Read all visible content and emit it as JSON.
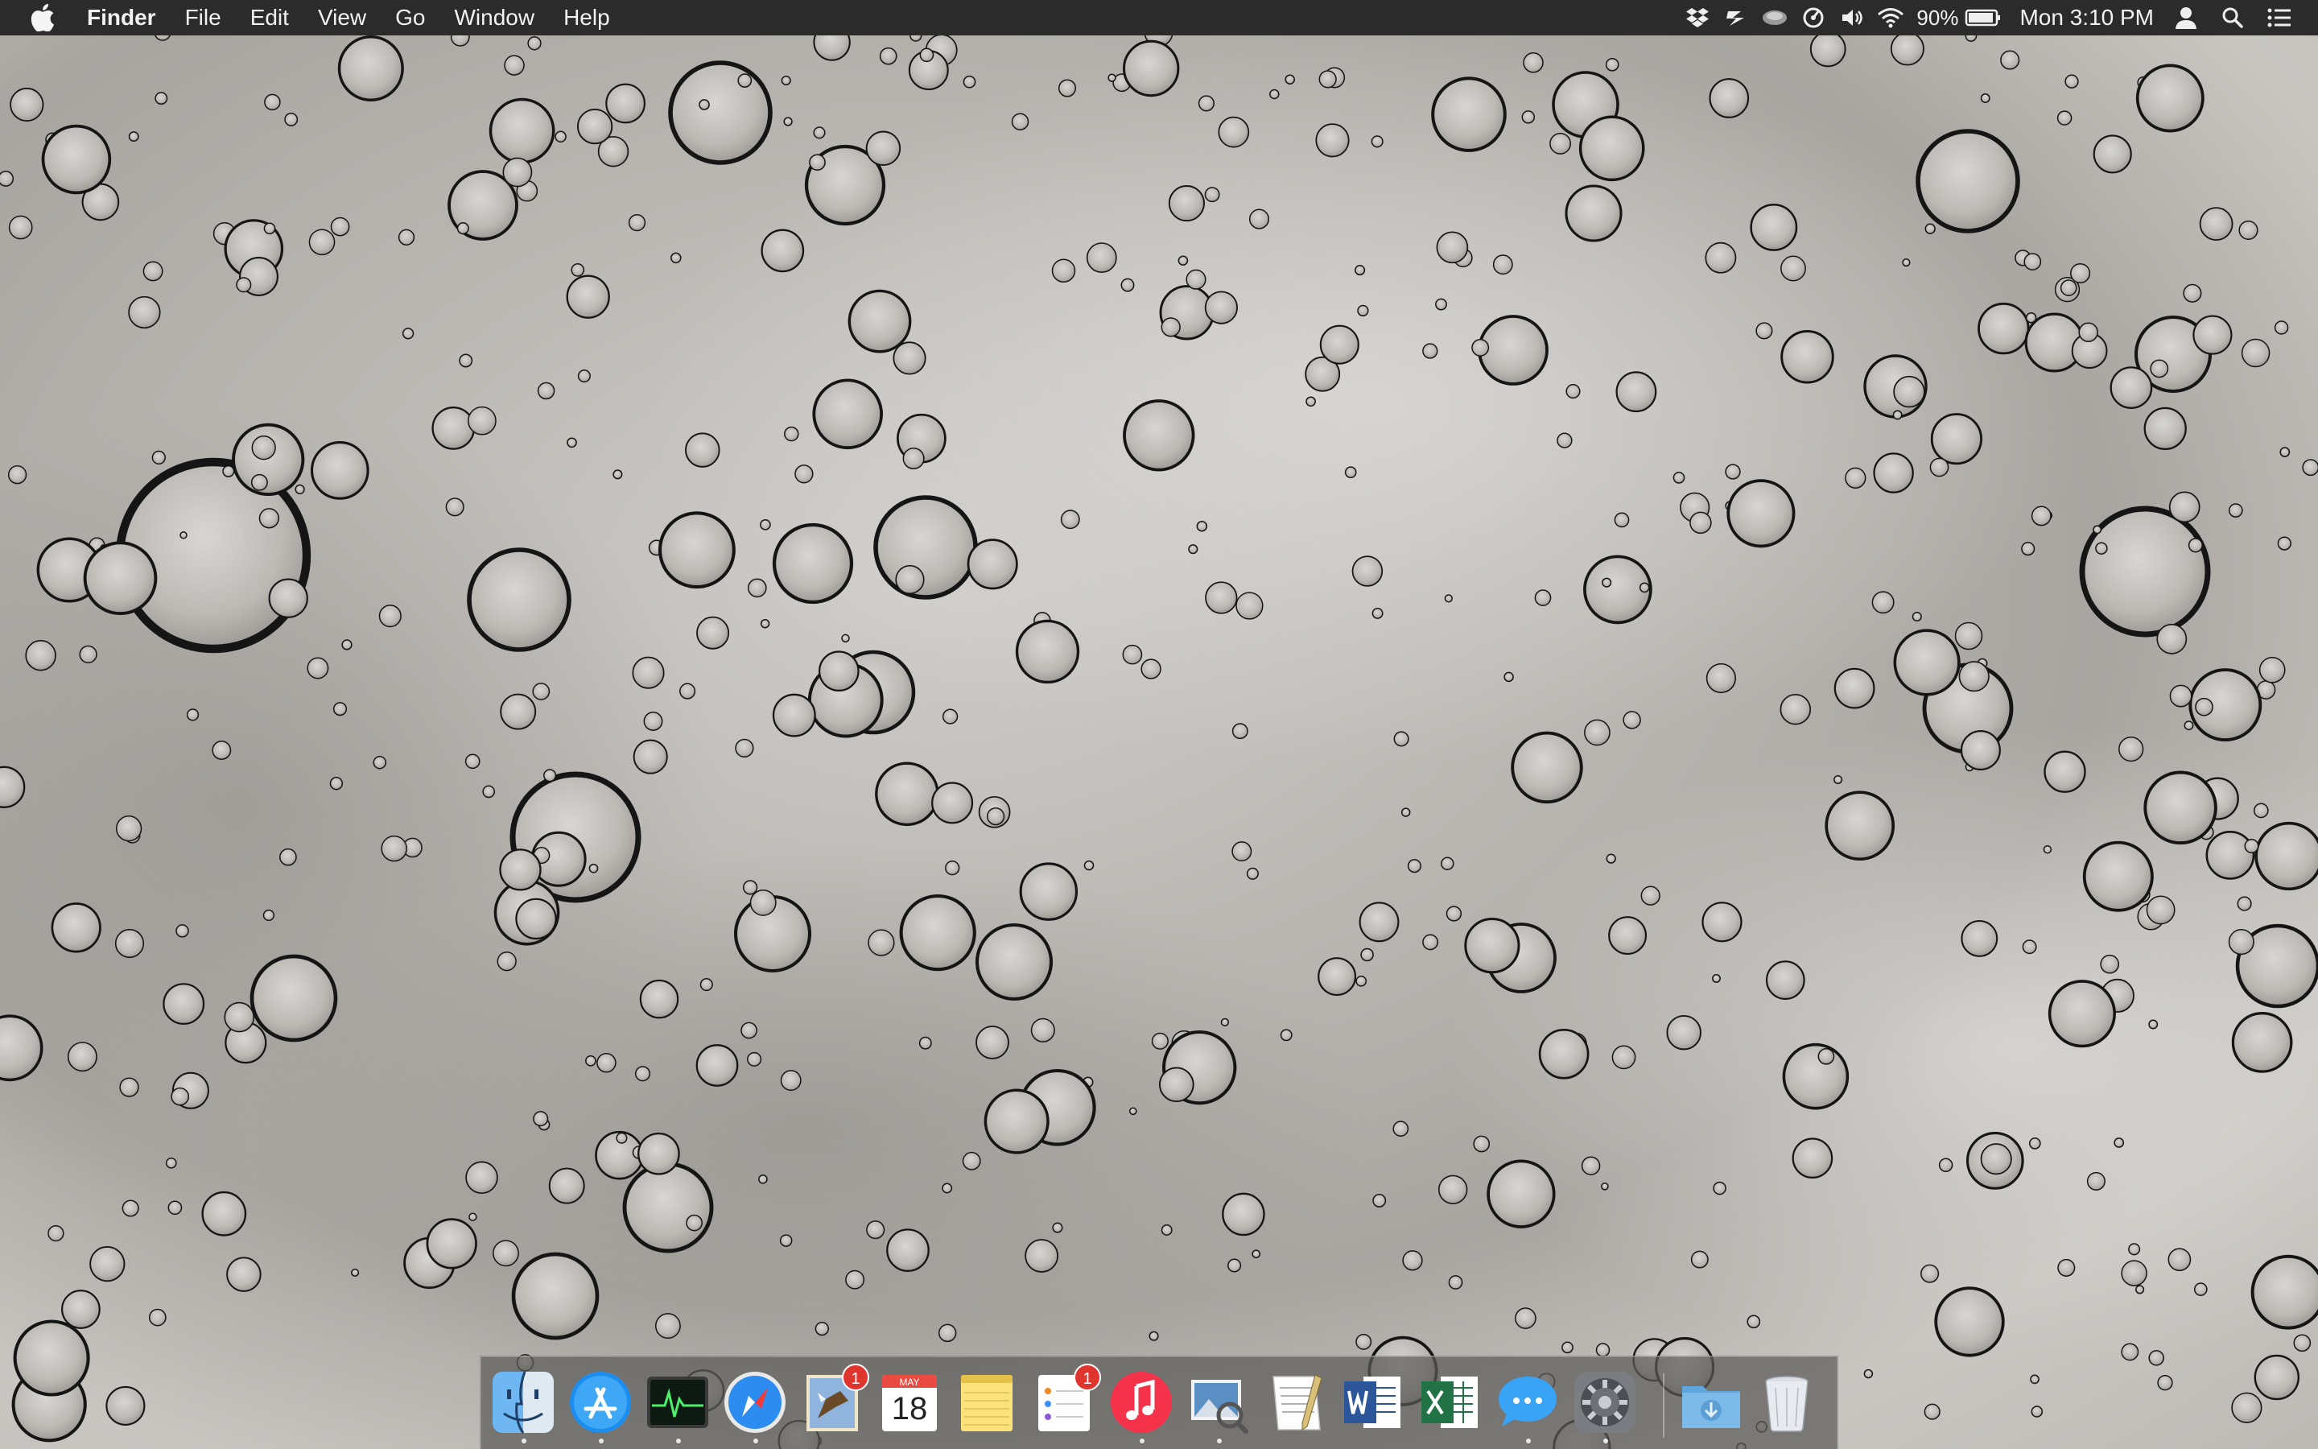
{
  "menubar": {
    "app_name": "Finder",
    "menus": [
      "File",
      "Edit",
      "View",
      "Go",
      "Window",
      "Help"
    ],
    "status_icons": [
      "dropbox-icon",
      "evernote-icon",
      "drive-icon",
      "sync-icon",
      "volume-icon",
      "wifi-icon"
    ],
    "battery_percent": "90%",
    "clock": "Mon 3:10 PM"
  },
  "dock": {
    "apps": [
      {
        "name": "Finder",
        "icon": "finder-icon",
        "running": true
      },
      {
        "name": "App Store",
        "icon": "app-store-icon",
        "running": true
      },
      {
        "name": "Activity Monitor",
        "icon": "activity-monitor-icon",
        "running": true
      },
      {
        "name": "Safari",
        "icon": "safari-icon",
        "running": true
      },
      {
        "name": "Mail",
        "icon": "mail-icon",
        "running": false,
        "badge": "1"
      },
      {
        "name": "Calendar",
        "icon": "calendar-icon",
        "running": false,
        "month": "MAY",
        "day": "18"
      },
      {
        "name": "Notes",
        "icon": "notes-icon",
        "running": false
      },
      {
        "name": "Reminders",
        "icon": "reminders-icon",
        "running": false,
        "badge": "1"
      },
      {
        "name": "iTunes",
        "icon": "itunes-icon",
        "running": true
      },
      {
        "name": "Preview",
        "icon": "preview-icon",
        "running": true
      },
      {
        "name": "TextEdit",
        "icon": "textedit-icon",
        "running": false
      },
      {
        "name": "Microsoft Word",
        "icon": "word-icon",
        "running": false
      },
      {
        "name": "Microsoft Excel",
        "icon": "excel-icon",
        "running": false
      },
      {
        "name": "Messages",
        "icon": "messages-icon",
        "running": true
      },
      {
        "name": "System Preferences",
        "icon": "system-preferences-icon",
        "running": true
      },
      {
        "name": "Downloads",
        "icon": "downloads-folder-icon",
        "running": false
      },
      {
        "name": "Trash",
        "icon": "trash-icon",
        "running": false
      }
    ]
  },
  "colors": {
    "menubar_bg": "#2b2b2b",
    "badge": "#e0352f",
    "wallpaper_base": "#bdbab6"
  }
}
